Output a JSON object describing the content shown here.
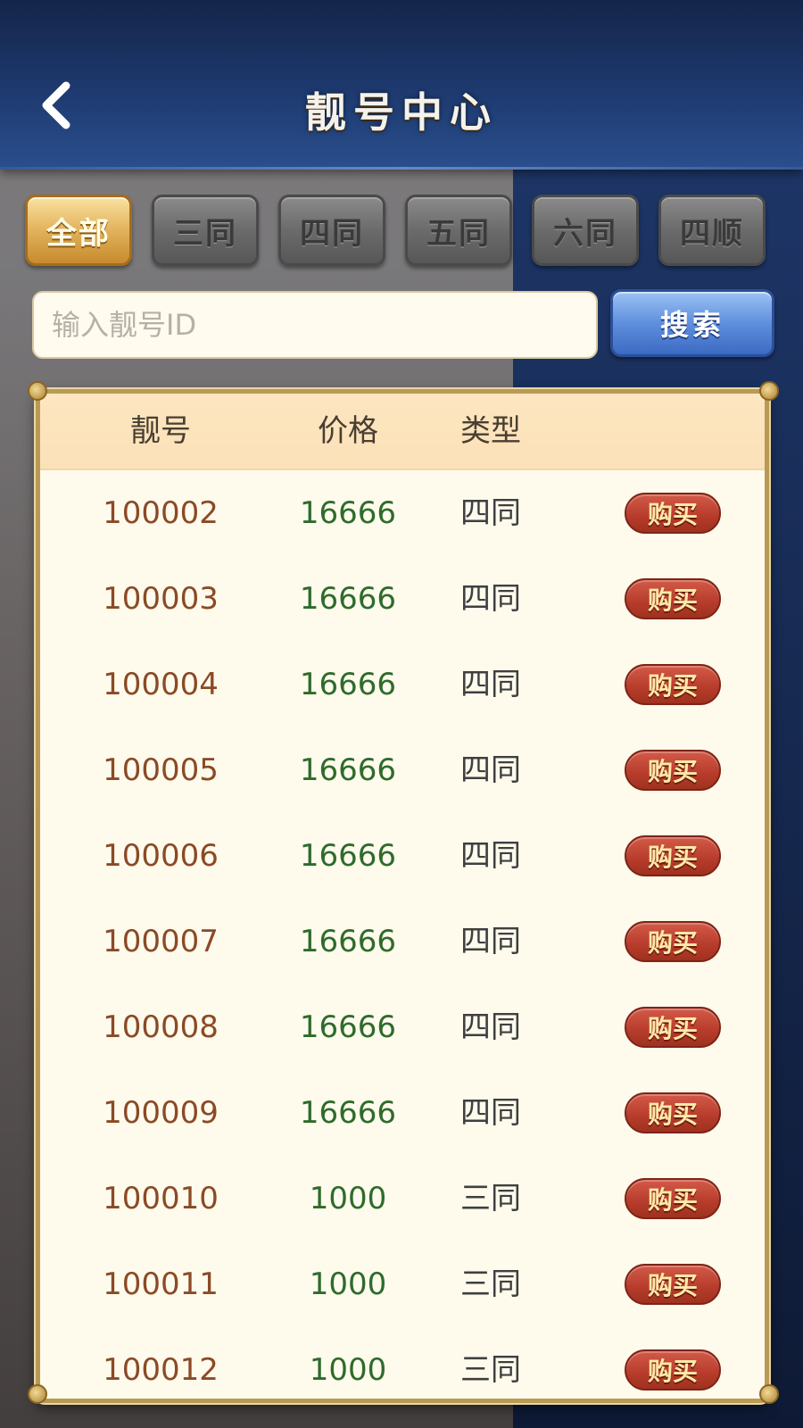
{
  "header": {
    "title": "靓号中心"
  },
  "tabs": [
    {
      "label": "全部",
      "active": true
    },
    {
      "label": "三同",
      "active": false
    },
    {
      "label": "四同",
      "active": false
    },
    {
      "label": "五同",
      "active": false
    },
    {
      "label": "六同",
      "active": false
    },
    {
      "label": "四顺",
      "active": false
    }
  ],
  "search": {
    "placeholder": "输入靓号ID",
    "value": "",
    "button_label": "搜索"
  },
  "table": {
    "columns": [
      "靓号",
      "价格",
      "类型"
    ],
    "buy_label": "购买",
    "rows": [
      {
        "id": "100002",
        "price": "16666",
        "type": "四同"
      },
      {
        "id": "100003",
        "price": "16666",
        "type": "四同"
      },
      {
        "id": "100004",
        "price": "16666",
        "type": "四同"
      },
      {
        "id": "100005",
        "price": "16666",
        "type": "四同"
      },
      {
        "id": "100006",
        "price": "16666",
        "type": "四同"
      },
      {
        "id": "100007",
        "price": "16666",
        "type": "四同"
      },
      {
        "id": "100008",
        "price": "16666",
        "type": "四同"
      },
      {
        "id": "100009",
        "price": "16666",
        "type": "四同"
      },
      {
        "id": "100010",
        "price": "1000",
        "type": "三同"
      },
      {
        "id": "100011",
        "price": "1000",
        "type": "三同"
      },
      {
        "id": "100012",
        "price": "1000",
        "type": "三同"
      }
    ]
  },
  "colors": {
    "id_text": "#8b4a25",
    "price_text": "#2f6b2b",
    "buy_button": "#b63b2b",
    "tab_active": "#e2b25c",
    "search_button": "#5f8fdd"
  },
  "icons": {
    "back": "chevron-left-icon"
  }
}
